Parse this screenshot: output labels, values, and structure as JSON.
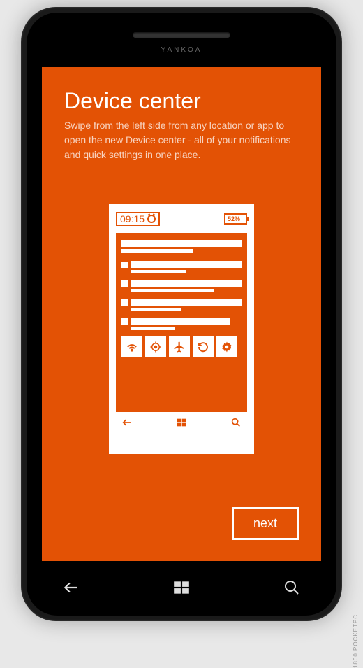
{
  "brand": "YANKOA",
  "header": {
    "title": "Device center",
    "subtitle": "Swipe from the left side from any location or app to open the new Device center - all of your notifications and quick settings in one place."
  },
  "mockup": {
    "time": "09:15",
    "battery": "52%"
  },
  "buttons": {
    "next": "next"
  },
  "colors": {
    "accent": "#e35205"
  },
  "watermark": "1800 POCKETPC"
}
